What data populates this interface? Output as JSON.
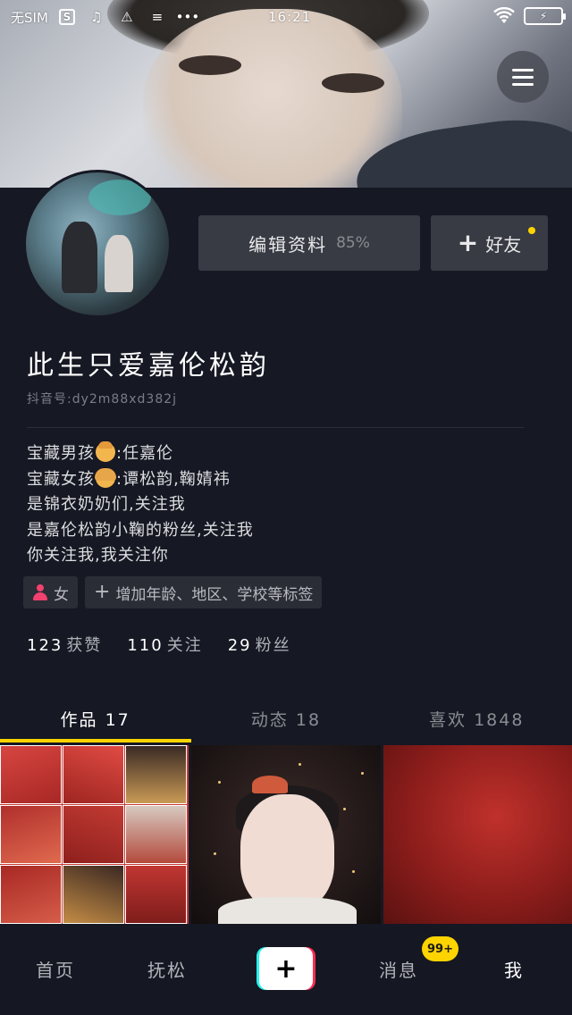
{
  "status_bar": {
    "carrier": "无SIM",
    "time": "16:21",
    "dots": "•••"
  },
  "profile": {
    "edit_button_label": "编辑资料",
    "edit_completion": "85%",
    "add_friend_label": "好友",
    "nickname": "此生只爱嘉伦松韵",
    "douyin_id": "抖音号:dy2m88xd382j",
    "bio": {
      "line1_prefix": "宝藏男孩",
      "line1_suffix": ":任嘉伦",
      "line2_prefix": "宝藏女孩",
      "line2_suffix": ":谭松韵,鞠婧祎",
      "line3": "是锦衣奶奶们,关注我",
      "line4": "是嘉伦松韵小鞠的粉丝,关注我",
      "line5": "你关注我,我关注你"
    },
    "tags": {
      "gender": "女",
      "add_tags": "增加年龄、地区、学校等标签"
    },
    "stats": {
      "likes_count": "123",
      "likes_label": "获赞",
      "following_count": "110",
      "following_label": "关注",
      "followers_count": "29",
      "followers_label": "粉丝"
    }
  },
  "tabs": [
    {
      "label": "作品 17",
      "active": true
    },
    {
      "label": "动态 18",
      "active": false
    },
    {
      "label": "喜欢 1848",
      "active": false
    }
  ],
  "bottom_nav": {
    "home": "首页",
    "follow": "抚松",
    "post": "+",
    "messages": "消息",
    "messages_badge": "99+",
    "me": "我"
  },
  "colors": {
    "background": "#161823",
    "accent_yellow": "#fdd400",
    "button_bg": "#393b44",
    "brand_cyan": "#25f4ee",
    "brand_red": "#fe2c55"
  }
}
